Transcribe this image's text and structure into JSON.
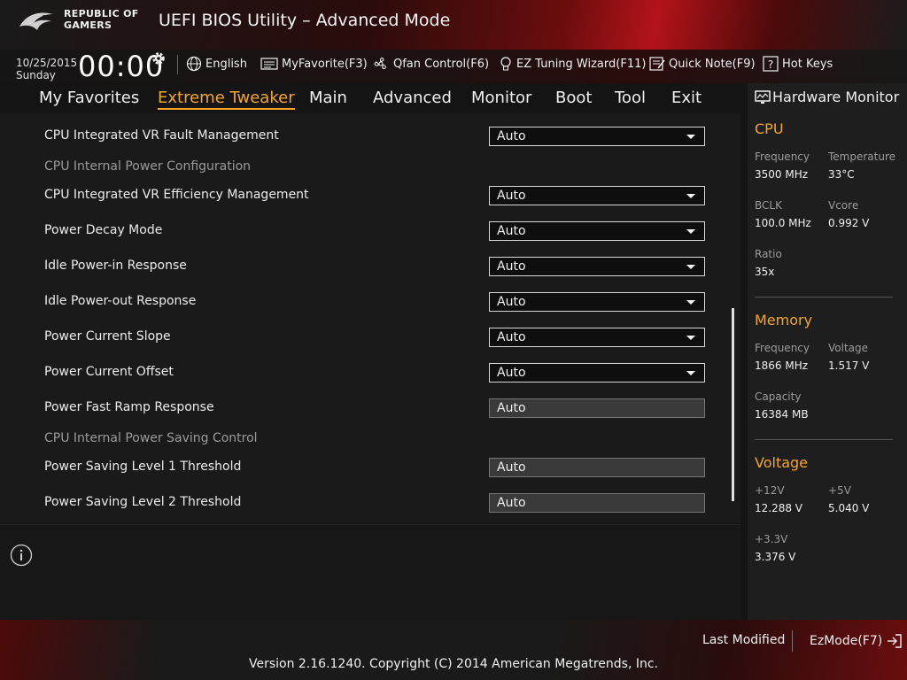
{
  "header": {
    "brand_line1": "REPUBLIC OF",
    "brand_line2": "GAMERS",
    "title": "UEFI BIOS Utility – Advanced Mode"
  },
  "topbar": {
    "date": "10/25/2015",
    "day": "Sunday",
    "time": "00:00",
    "language": "English",
    "myfavorite": "MyFavorite(F3)",
    "qfan": "Qfan Control(F6)",
    "ez_tuning": "EZ Tuning Wizard(F11)",
    "quick_note": "Quick Note(F9)",
    "hot_keys": "Hot Keys"
  },
  "tabs": [
    {
      "label": "My Favorites"
    },
    {
      "label": "Extreme Tweaker",
      "active": true
    },
    {
      "label": "Main"
    },
    {
      "label": "Advanced"
    },
    {
      "label": "Monitor"
    },
    {
      "label": "Boot"
    },
    {
      "label": "Tool"
    },
    {
      "label": "Exit"
    }
  ],
  "settings": [
    {
      "label": "CPU Integrated VR Fault Management",
      "value": "Auto",
      "control": "select"
    },
    {
      "label": "CPU Internal Power Configuration",
      "control": "section"
    },
    {
      "label": "CPU Integrated VR Efficiency Management",
      "value": "Auto",
      "control": "select"
    },
    {
      "label": "Power Decay Mode",
      "value": "Auto",
      "control": "select"
    },
    {
      "label": "Idle Power-in Response",
      "value": "Auto",
      "control": "select"
    },
    {
      "label": "Idle Power-out Response",
      "value": "Auto",
      "control": "select"
    },
    {
      "label": "Power Current Slope",
      "value": "Auto",
      "control": "select"
    },
    {
      "label": "Power Current Offset",
      "value": "Auto",
      "control": "select"
    },
    {
      "label": "Power Fast Ramp Response",
      "value": "Auto",
      "control": "text"
    },
    {
      "label": "CPU Internal Power Saving Control",
      "control": "section"
    },
    {
      "label": "Power Saving Level 1 Threshold",
      "value": "Auto",
      "control": "text"
    },
    {
      "label": "Power Saving Level 2 Threshold",
      "value": "Auto",
      "control": "text"
    }
  ],
  "hardware_monitor": {
    "title": "Hardware Monitor",
    "cpu": {
      "title": "CPU",
      "frequency_label": "Frequency",
      "frequency": "3500 MHz",
      "temperature_label": "Temperature",
      "temperature": "33°C",
      "bclk_label": "BCLK",
      "bclk": "100.0 MHz",
      "vcore_label": "Vcore",
      "vcore": "0.992 V",
      "ratio_label": "Ratio",
      "ratio": "35x"
    },
    "memory": {
      "title": "Memory",
      "frequency_label": "Frequency",
      "frequency": "1866 MHz",
      "voltage_label": "Voltage",
      "voltage": "1.517 V",
      "capacity_label": "Capacity",
      "capacity": "16384 MB"
    },
    "voltage": {
      "title": "Voltage",
      "v12_label": "+12V",
      "v12": "12.288 V",
      "v5_label": "+5V",
      "v5": "5.040 V",
      "v33_label": "+3.3V",
      "v33": "3.376 V"
    }
  },
  "footer": {
    "last_modified": "Last Modified",
    "ezmode": "EzMode(F7)",
    "copyright": "Version 2.16.1240. Copyright (C) 2014 American Megatrends, Inc."
  },
  "colors": {
    "accent": "#f5a623",
    "brand_red": "#b3131a"
  }
}
